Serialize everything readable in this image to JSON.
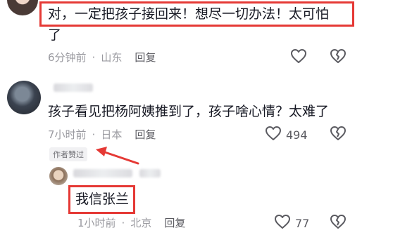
{
  "comments": [
    {
      "text_line1": "对，一定把孩子接回来！想尽一切办法！太可怕",
      "text_line2": "了",
      "time": "6分钟前",
      "location": "山东",
      "reply_label": "回复",
      "like_count": ""
    },
    {
      "text": "孩子看见把杨阿姨推到了，孩子啥心情？太难了",
      "time": "7小时前",
      "location": "日本",
      "reply_label": "回复",
      "like_count": "494",
      "badge": "作者赞过"
    },
    {
      "text": "我信张兰",
      "time": "1小时前",
      "location": "北京",
      "reply_label": "回复",
      "like_count": "77"
    }
  ],
  "separator": "·",
  "colors": {
    "highlight_box": "#e53935",
    "arrow": "#e53935",
    "meta_text": "#9a9aa0",
    "body_text": "#161823"
  },
  "icons": [
    "heart-outline-icon",
    "broken-heart-icon"
  ]
}
